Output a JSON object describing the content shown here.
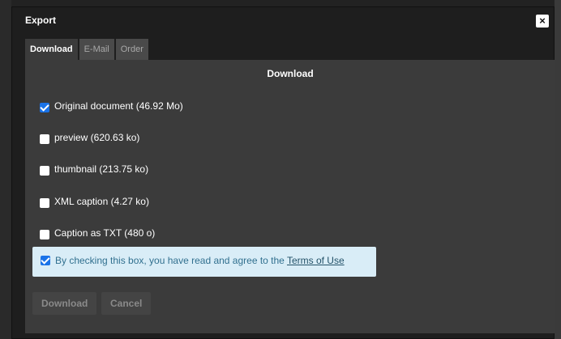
{
  "dialog": {
    "title": "Export",
    "close_glyph": "×"
  },
  "tabs": [
    {
      "label": "Download"
    },
    {
      "label": "E-Mail"
    },
    {
      "label": "Order"
    }
  ],
  "panel": {
    "heading": "Download",
    "options": [
      {
        "label": "Original document (46.92 Mo)",
        "checked": true
      },
      {
        "label": "preview (620.63 ko)",
        "checked": false
      },
      {
        "label": "thumbnail (213.75 ko)",
        "checked": false
      },
      {
        "label": "XML caption (4.27 ko)",
        "checked": false
      },
      {
        "label": "Caption as TXT (480 o)",
        "checked": false
      }
    ],
    "terms": {
      "checked": true,
      "text": "By checking this box, you have read and agree to the ",
      "link": "Terms of Use"
    },
    "buttons": {
      "download": "Download",
      "cancel": "Cancel"
    }
  },
  "colors": {
    "accent": "#1a73e8",
    "terms_bg": "#d9edf7",
    "terms_text": "#31708f"
  }
}
